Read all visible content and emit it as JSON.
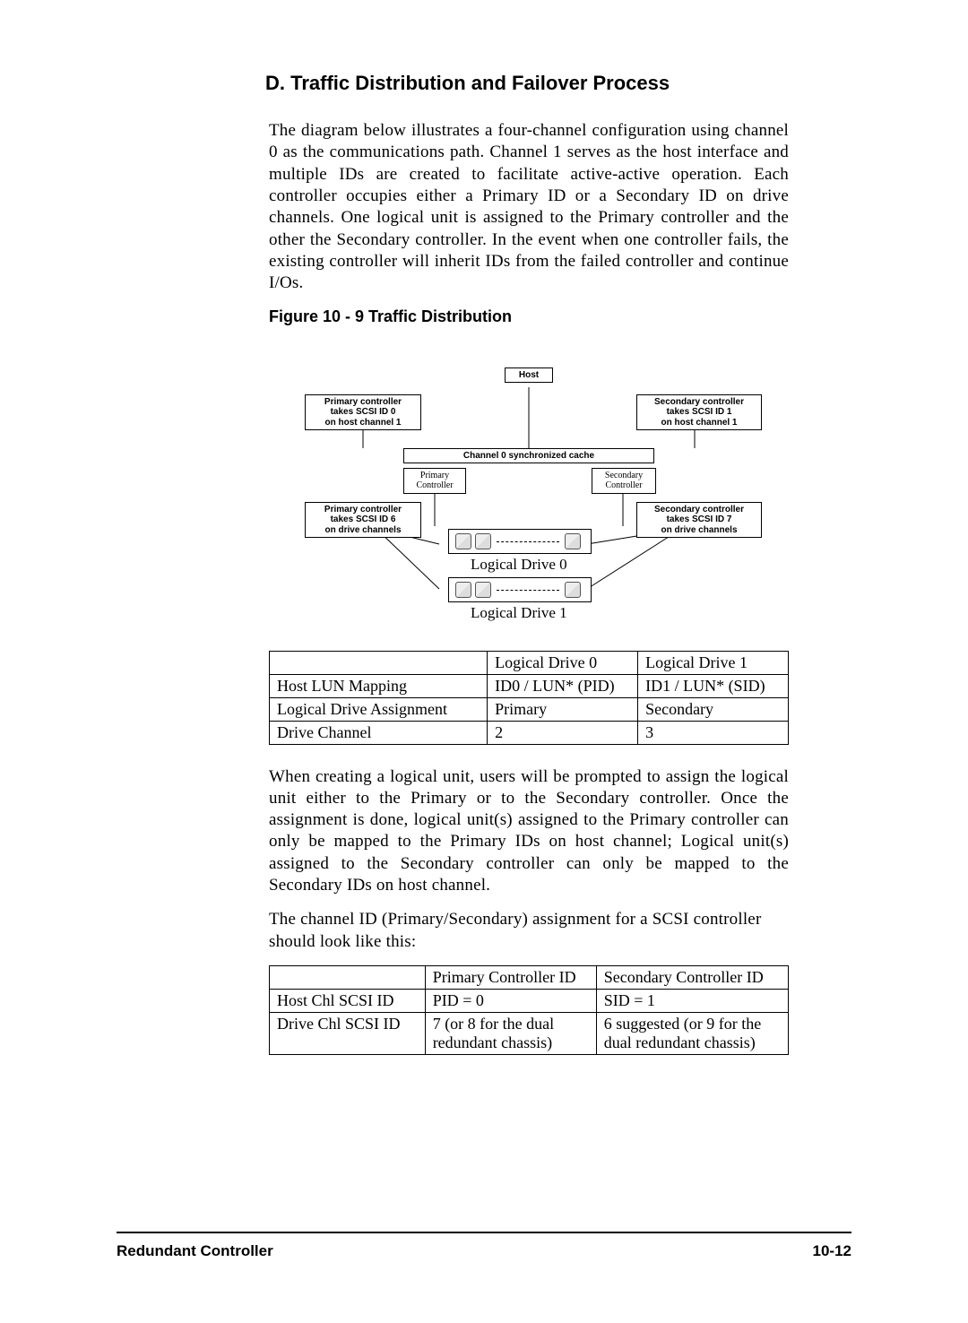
{
  "heading": "D. Traffic Distribution and Failover Process",
  "para1": "The diagram below illustrates a four-channel configuration using channel 0 as the communications path.  Channel 1 serves as the host interface and multiple IDs are created to facilitate active-active operation.   Each controller occupies either a Primary ID or a Secondary ID on drive channels.  One logical unit is assigned to the Primary controller and the other the Secondary controller.  In the event when one controller fails, the existing controller will inherit IDs from the failed controller and continue I/Os.",
  "fig_caption": "Figure 10 - 9 Traffic Distribution",
  "diagram": {
    "host": "Host",
    "pri_host_note": "Primary controller\ntakes SCSI ID 0\non host channel 1",
    "sec_host_note": "Secondary controller\ntakes SCSI ID 1\non host channel 1",
    "sync": "Channel 0 synchronized cache",
    "pri_ctrl": "Primary\nController",
    "sec_ctrl": "Secondary\nController",
    "pri_drive_note": "Primary controller\ntakes SCSI ID 6\non drive channels",
    "sec_drive_note": "Secondary controller\ntakes SCSI ID 7\non drive channels",
    "ld0": "Logical Drive 0",
    "ld1": "Logical Drive 1"
  },
  "table1": {
    "headers": [
      "",
      "Logical Drive 0",
      "Logical Drive 1"
    ],
    "rows": [
      [
        "Host LUN Mapping",
        "ID0 / LUN* (PID)",
        "ID1 / LUN* (SID)"
      ],
      [
        "Logical Drive Assignment",
        "Primary",
        "Secondary"
      ],
      [
        "Drive Channel",
        "2",
        "3"
      ]
    ]
  },
  "para2": "When creating a logical unit, users will be prompted to assign the logical unit either to the Primary or to the Secondary controller.  Once the assignment is done, logical unit(s) assigned to the Primary controller can only be mapped to the Primary IDs on host channel; Logical unit(s) assigned to the Secondary controller can only be mapped to the Secondary IDs on host channel.",
  "para3": "The channel ID (Primary/Secondary) assignment for a SCSI controller should look like this:",
  "table2": {
    "headers": [
      "",
      "Primary Controller ID",
      "Secondary Controller ID"
    ],
    "rows": [
      [
        "Host Chl SCSI ID",
        "PID = 0",
        "SID = 1"
      ],
      [
        "Drive Chl SCSI ID",
        "7 (or 8 for the dual redundant chassis)",
        "6 suggested (or 9 for the dual redundant chassis)"
      ]
    ]
  },
  "footer": {
    "title": "Redundant Controller",
    "page": "10-12"
  }
}
